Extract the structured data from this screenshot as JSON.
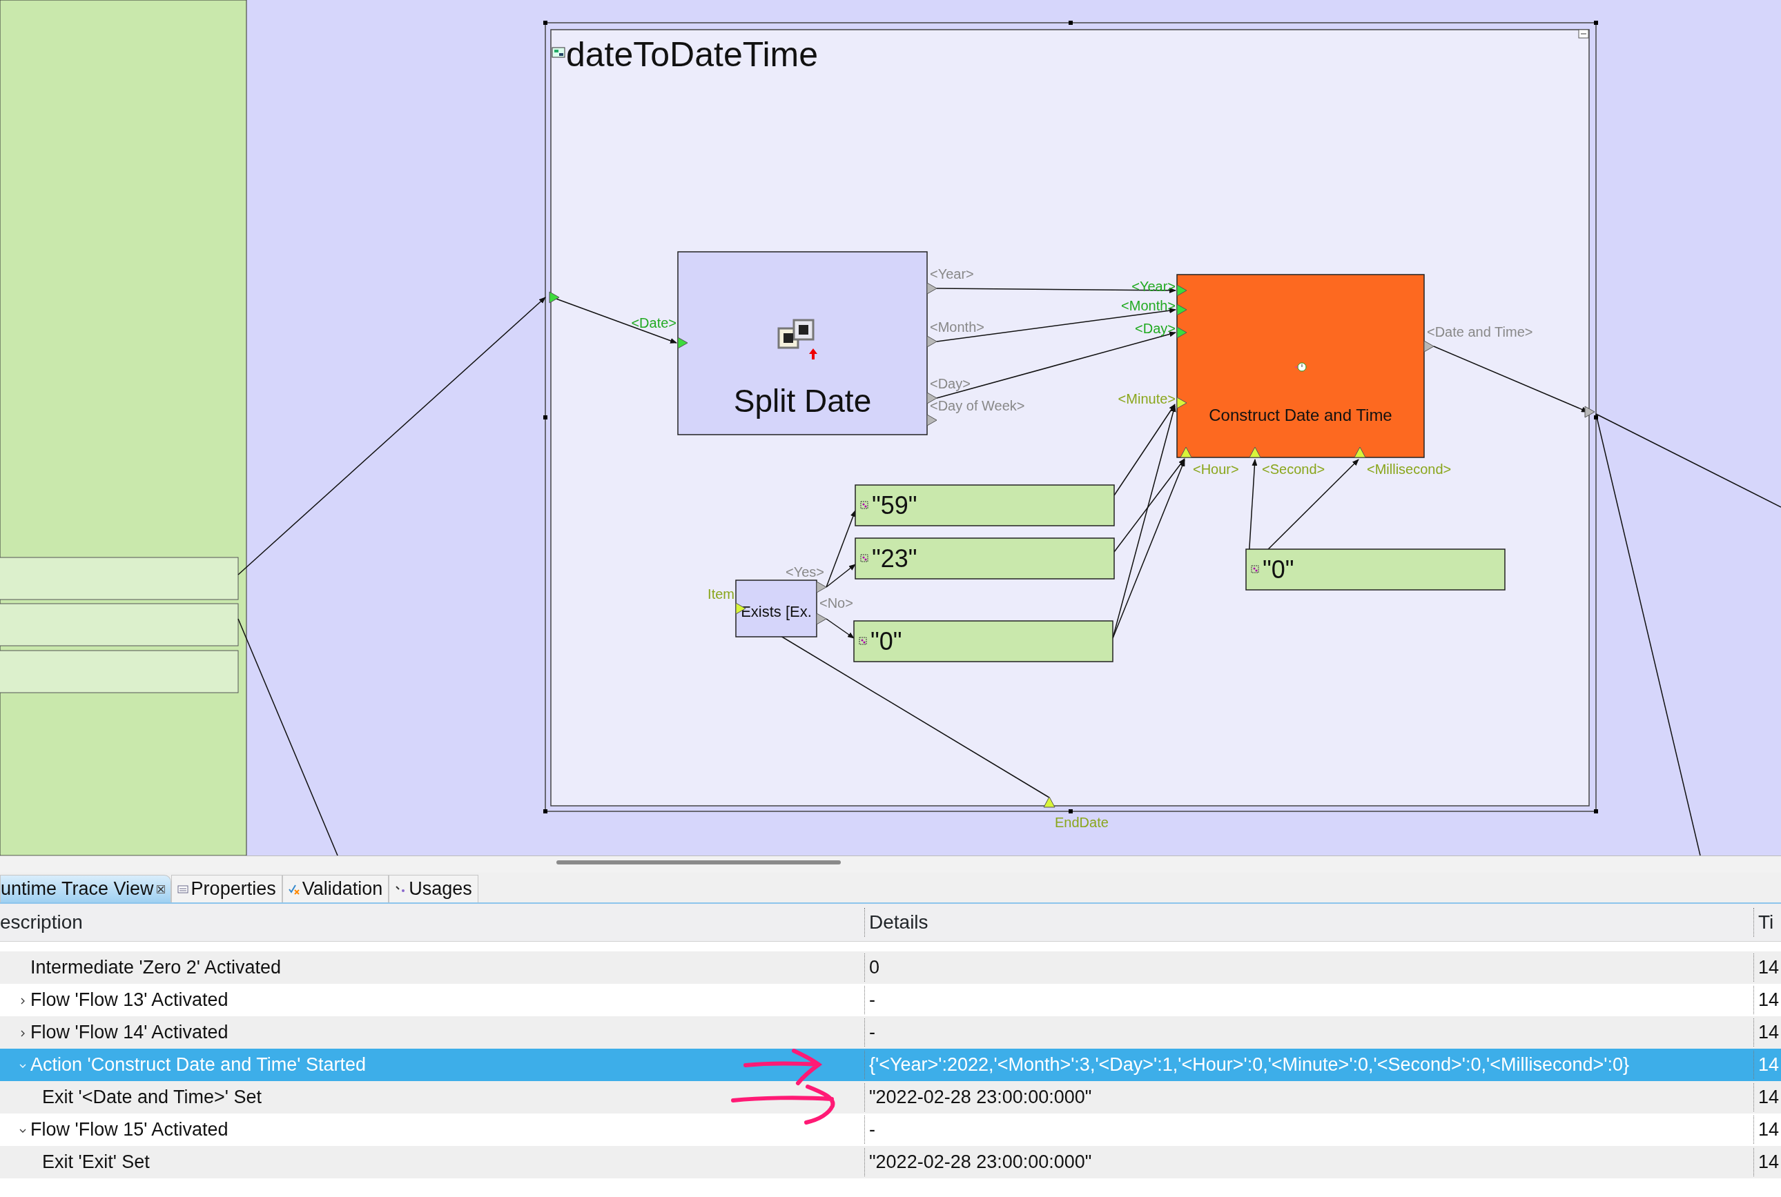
{
  "diagram": {
    "group": {
      "title": "dateToDateTime",
      "bottom_port": {
        "label": "EndDate",
        "optional": true
      }
    },
    "nodes": [
      {
        "kind": "action",
        "title": "Split Date",
        "color": "#d5d5fa",
        "inputs": [
          {
            "label": "<Date>",
            "optional": false
          }
        ],
        "outputs": [
          "<Year>",
          "<Month>",
          "<Day>",
          "<Day of Week>"
        ]
      },
      {
        "kind": "action",
        "title": "Construct Date and Time",
        "color": "#fd6920",
        "inputs": [
          {
            "label": "<Year>",
            "optional": false
          },
          {
            "label": "<Month>",
            "optional": false
          },
          {
            "label": "<Day>",
            "optional": false
          },
          {
            "label": "<Minute>",
            "optional": true
          }
        ],
        "bottom_inputs": [
          {
            "label": "<Hour>",
            "optional": true
          },
          {
            "label": "<Second>",
            "optional": true
          },
          {
            "label": "<Millisecond>",
            "optional": true
          }
        ],
        "outputs": [
          "<Date and Time>"
        ]
      },
      {
        "kind": "decision",
        "title": "Exists [Ex.",
        "color": "#d5d5fa",
        "inputs": [
          {
            "label": "Item",
            "optional": true
          }
        ],
        "outputs": [
          "<Yes>",
          "<No>"
        ]
      },
      {
        "kind": "constant",
        "value": "\"59\""
      },
      {
        "kind": "constant",
        "value": "\"23\""
      },
      {
        "kind": "constant",
        "value": "\"0\""
      },
      {
        "kind": "constant",
        "value": "\"0\""
      }
    ]
  },
  "tabs": [
    {
      "label": "untime Trace View",
      "selected": true
    },
    {
      "label": "Properties",
      "selected": false
    },
    {
      "label": "Validation",
      "selected": false
    },
    {
      "label": "Usages",
      "selected": false
    }
  ],
  "table": {
    "columns": [
      "escription",
      "Details",
      "Ti"
    ],
    "rows": [
      {
        "description": "Intermediate 'Zero 2' Activated",
        "details": "0",
        "time": "14",
        "selected": false,
        "children": []
      },
      {
        "description": "Flow 'Flow 13' Activated",
        "details": "-",
        "time": "14",
        "selected": false,
        "expanded": false,
        "children": []
      },
      {
        "description": "Flow 'Flow 14' Activated",
        "details": "-",
        "time": "14",
        "selected": false,
        "expanded": false,
        "children": []
      },
      {
        "description": "Action 'Construct Date and Time' Started",
        "details": "{'<Year>':2022,'<Month>':3,'<Day>':1,'<Hour>':0,'<Minute>':0,'<Second>':0,'<Millisecond>':0}",
        "time": "14",
        "selected": true,
        "expanded": true,
        "children": [
          {
            "description": "Exit '<Date and Time>' Set",
            "details": "\"2022-02-28 23:00:00:000\"",
            "time": "14",
            "selected": false
          }
        ]
      },
      {
        "description": "Flow 'Flow 15' Activated",
        "details": "-",
        "time": "14",
        "selected": false,
        "expanded": true,
        "children": [
          {
            "description": "Exit 'Exit' Set",
            "details": "\"2022-02-28 23:00:00:000\"",
            "time": "14",
            "selected": false
          }
        ]
      }
    ]
  }
}
